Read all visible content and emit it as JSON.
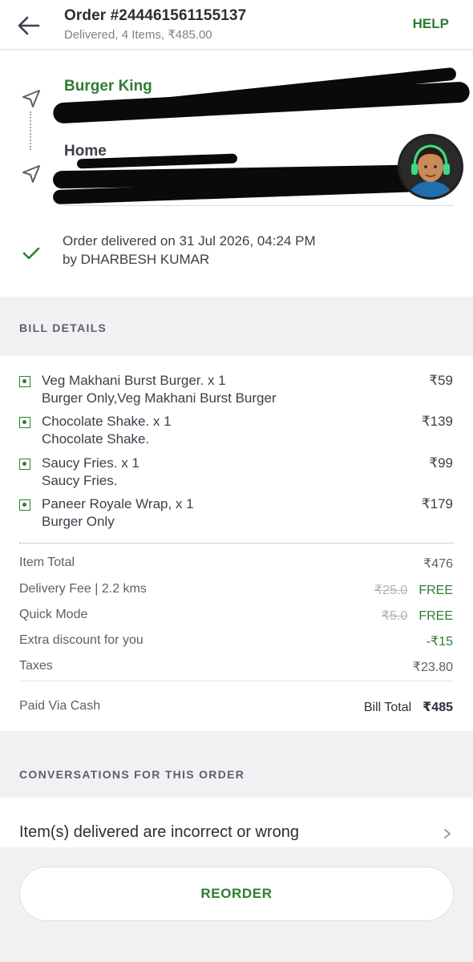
{
  "header": {
    "order_title": "Order #244461561155137",
    "order_summary": "Delivered, 4 Items, ₹485.00",
    "help_label": "HELP"
  },
  "route": {
    "restaurant_name": "Burger King",
    "home_label": "Home",
    "delivered_line1": "Order delivered on 31 Jul 2026, 04:24 PM",
    "delivered_line2": "by DHARBESH KUMAR"
  },
  "bill": {
    "section_label": "BILL DETAILS",
    "items": [
      {
        "name": "Veg Makhani Burst Burger. x 1",
        "desc": "Burger Only,Veg Makhani Burst Burger",
        "price": "₹59"
      },
      {
        "name": "Chocolate Shake. x 1",
        "desc": "Chocolate Shake.",
        "price": "₹139"
      },
      {
        "name": "Saucy Fries. x 1",
        "desc": "Saucy Fries.",
        "price": "₹99"
      },
      {
        "name": "Paneer Royale Wrap, x 1",
        "desc": "Burger Only",
        "price": "₹179"
      }
    ],
    "item_total_label": "Item Total",
    "item_total_value": "₹476",
    "delivery_fee_label": "Delivery Fee | 2.2 kms",
    "delivery_fee_original": "₹25.0",
    "delivery_fee_value": "FREE",
    "quick_mode_label": "Quick Mode",
    "quick_mode_original": "₹5.0",
    "quick_mode_value": "FREE",
    "discount_label": "Extra discount for you",
    "discount_value": "-₹15",
    "taxes_label": "Taxes",
    "taxes_value": "₹23.80",
    "paid_via": "Paid Via Cash",
    "bill_total_label": "Bill Total",
    "bill_total_value": "₹485"
  },
  "conversations": {
    "section_label": "CONVERSATIONS FOR THIS ORDER",
    "issue_text": "Item(s) delivered are incorrect or wrong"
  },
  "footer": {
    "reorder_label": "REORDER"
  },
  "colors": {
    "accent_green": "#2e7d32",
    "background": "#f1f1f3",
    "text_dark": "#2b2e38"
  }
}
